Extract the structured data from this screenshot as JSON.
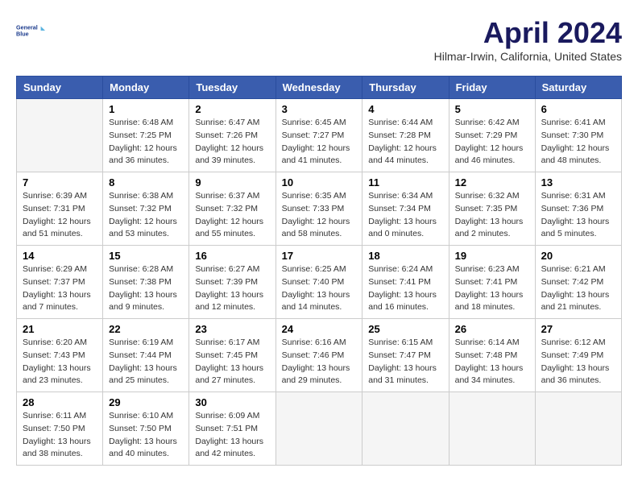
{
  "header": {
    "logo_line1": "General",
    "logo_line2": "Blue",
    "month": "April 2024",
    "location": "Hilmar-Irwin, California, United States"
  },
  "weekdays": [
    "Sunday",
    "Monday",
    "Tuesday",
    "Wednesday",
    "Thursday",
    "Friday",
    "Saturday"
  ],
  "weeks": [
    [
      {
        "day": "",
        "info": ""
      },
      {
        "day": "1",
        "info": "Sunrise: 6:48 AM\nSunset: 7:25 PM\nDaylight: 12 hours\nand 36 minutes."
      },
      {
        "day": "2",
        "info": "Sunrise: 6:47 AM\nSunset: 7:26 PM\nDaylight: 12 hours\nand 39 minutes."
      },
      {
        "day": "3",
        "info": "Sunrise: 6:45 AM\nSunset: 7:27 PM\nDaylight: 12 hours\nand 41 minutes."
      },
      {
        "day": "4",
        "info": "Sunrise: 6:44 AM\nSunset: 7:28 PM\nDaylight: 12 hours\nand 44 minutes."
      },
      {
        "day": "5",
        "info": "Sunrise: 6:42 AM\nSunset: 7:29 PM\nDaylight: 12 hours\nand 46 minutes."
      },
      {
        "day": "6",
        "info": "Sunrise: 6:41 AM\nSunset: 7:30 PM\nDaylight: 12 hours\nand 48 minutes."
      }
    ],
    [
      {
        "day": "7",
        "info": "Sunrise: 6:39 AM\nSunset: 7:31 PM\nDaylight: 12 hours\nand 51 minutes."
      },
      {
        "day": "8",
        "info": "Sunrise: 6:38 AM\nSunset: 7:32 PM\nDaylight: 12 hours\nand 53 minutes."
      },
      {
        "day": "9",
        "info": "Sunrise: 6:37 AM\nSunset: 7:32 PM\nDaylight: 12 hours\nand 55 minutes."
      },
      {
        "day": "10",
        "info": "Sunrise: 6:35 AM\nSunset: 7:33 PM\nDaylight: 12 hours\nand 58 minutes."
      },
      {
        "day": "11",
        "info": "Sunrise: 6:34 AM\nSunset: 7:34 PM\nDaylight: 13 hours\nand 0 minutes."
      },
      {
        "day": "12",
        "info": "Sunrise: 6:32 AM\nSunset: 7:35 PM\nDaylight: 13 hours\nand 2 minutes."
      },
      {
        "day": "13",
        "info": "Sunrise: 6:31 AM\nSunset: 7:36 PM\nDaylight: 13 hours\nand 5 minutes."
      }
    ],
    [
      {
        "day": "14",
        "info": "Sunrise: 6:29 AM\nSunset: 7:37 PM\nDaylight: 13 hours\nand 7 minutes."
      },
      {
        "day": "15",
        "info": "Sunrise: 6:28 AM\nSunset: 7:38 PM\nDaylight: 13 hours\nand 9 minutes."
      },
      {
        "day": "16",
        "info": "Sunrise: 6:27 AM\nSunset: 7:39 PM\nDaylight: 13 hours\nand 12 minutes."
      },
      {
        "day": "17",
        "info": "Sunrise: 6:25 AM\nSunset: 7:40 PM\nDaylight: 13 hours\nand 14 minutes."
      },
      {
        "day": "18",
        "info": "Sunrise: 6:24 AM\nSunset: 7:41 PM\nDaylight: 13 hours\nand 16 minutes."
      },
      {
        "day": "19",
        "info": "Sunrise: 6:23 AM\nSunset: 7:41 PM\nDaylight: 13 hours\nand 18 minutes."
      },
      {
        "day": "20",
        "info": "Sunrise: 6:21 AM\nSunset: 7:42 PM\nDaylight: 13 hours\nand 21 minutes."
      }
    ],
    [
      {
        "day": "21",
        "info": "Sunrise: 6:20 AM\nSunset: 7:43 PM\nDaylight: 13 hours\nand 23 minutes."
      },
      {
        "day": "22",
        "info": "Sunrise: 6:19 AM\nSunset: 7:44 PM\nDaylight: 13 hours\nand 25 minutes."
      },
      {
        "day": "23",
        "info": "Sunrise: 6:17 AM\nSunset: 7:45 PM\nDaylight: 13 hours\nand 27 minutes."
      },
      {
        "day": "24",
        "info": "Sunrise: 6:16 AM\nSunset: 7:46 PM\nDaylight: 13 hours\nand 29 minutes."
      },
      {
        "day": "25",
        "info": "Sunrise: 6:15 AM\nSunset: 7:47 PM\nDaylight: 13 hours\nand 31 minutes."
      },
      {
        "day": "26",
        "info": "Sunrise: 6:14 AM\nSunset: 7:48 PM\nDaylight: 13 hours\nand 34 minutes."
      },
      {
        "day": "27",
        "info": "Sunrise: 6:12 AM\nSunset: 7:49 PM\nDaylight: 13 hours\nand 36 minutes."
      }
    ],
    [
      {
        "day": "28",
        "info": "Sunrise: 6:11 AM\nSunset: 7:50 PM\nDaylight: 13 hours\nand 38 minutes."
      },
      {
        "day": "29",
        "info": "Sunrise: 6:10 AM\nSunset: 7:50 PM\nDaylight: 13 hours\nand 40 minutes."
      },
      {
        "day": "30",
        "info": "Sunrise: 6:09 AM\nSunset: 7:51 PM\nDaylight: 13 hours\nand 42 minutes."
      },
      {
        "day": "",
        "info": ""
      },
      {
        "day": "",
        "info": ""
      },
      {
        "day": "",
        "info": ""
      },
      {
        "day": "",
        "info": ""
      }
    ]
  ]
}
